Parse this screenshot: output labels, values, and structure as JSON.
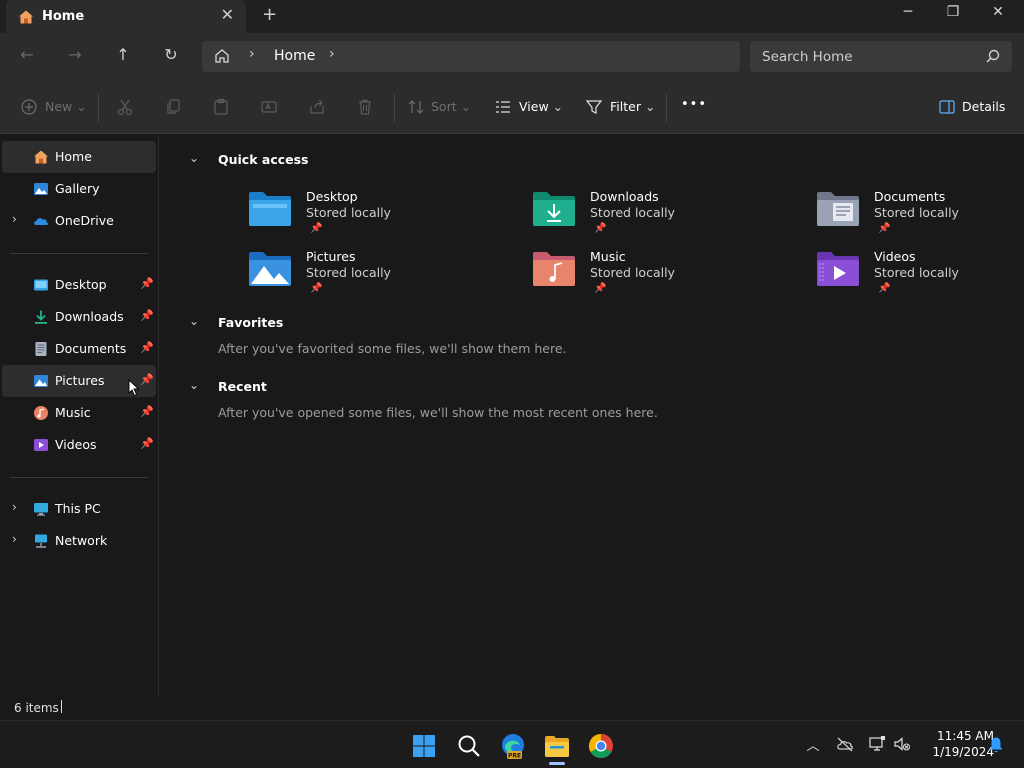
{
  "window": {
    "tab_title": "Home",
    "new_tab_glyph": "+",
    "close_tab_glyph": "✕",
    "minimize_glyph": "─",
    "restore_glyph": "❐",
    "close_glyph": "✕"
  },
  "nav": {
    "back_glyph": "←",
    "forward_glyph": "→",
    "up_glyph": "↑",
    "refresh_glyph": "↻",
    "breadcrumb": [
      "Home"
    ],
    "search_placeholder": "Search Home"
  },
  "commands": {
    "new_label": "New",
    "sort_label": "Sort",
    "view_label": "View",
    "filter_label": "Filter",
    "more_label": "•••",
    "details_label": "Details"
  },
  "sidebar": {
    "top": [
      {
        "label": "Home",
        "icon": "home-icon"
      },
      {
        "label": "Gallery",
        "icon": "gallery-icon"
      },
      {
        "label": "OneDrive",
        "icon": "onedrive-icon"
      }
    ],
    "pinned": [
      {
        "label": "Desktop",
        "icon": "desktop-folder-icon"
      },
      {
        "label": "Downloads",
        "icon": "downloads-folder-icon"
      },
      {
        "label": "Documents",
        "icon": "documents-folder-icon"
      },
      {
        "label": "Pictures",
        "icon": "pictures-folder-icon"
      },
      {
        "label": "Music",
        "icon": "music-folder-icon"
      },
      {
        "label": "Videos",
        "icon": "videos-folder-icon"
      }
    ],
    "bottom": [
      {
        "label": "This PC",
        "icon": "this-pc-icon"
      },
      {
        "label": "Network",
        "icon": "network-icon"
      }
    ]
  },
  "main": {
    "quick_access_title": "Quick access",
    "quick_access": [
      {
        "name": "Desktop",
        "sub": "Stored locally",
        "color": "#3aa6e8"
      },
      {
        "name": "Downloads",
        "sub": "Stored locally",
        "color": "#1fae8e"
      },
      {
        "name": "Documents",
        "sub": "Stored locally",
        "color": "#9aa3b5"
      },
      {
        "name": "Pictures",
        "sub": "Stored locally",
        "color": "#3a92e0"
      },
      {
        "name": "Music",
        "sub": "Stored locally",
        "color": "#e8846a"
      },
      {
        "name": "Videos",
        "sub": "Stored locally",
        "color": "#8a4fd6"
      }
    ],
    "favorites_title": "Favorites",
    "favorites_empty": "After you've favorited some files, we'll show them here.",
    "recent_title": "Recent",
    "recent_empty": "After you've opened some files, we'll show the most recent ones here."
  },
  "status": {
    "items_count": "6 items"
  },
  "taskbar": {
    "time": "11:45 AM",
    "date": "1/19/2024",
    "edge_badge": "PRE"
  }
}
